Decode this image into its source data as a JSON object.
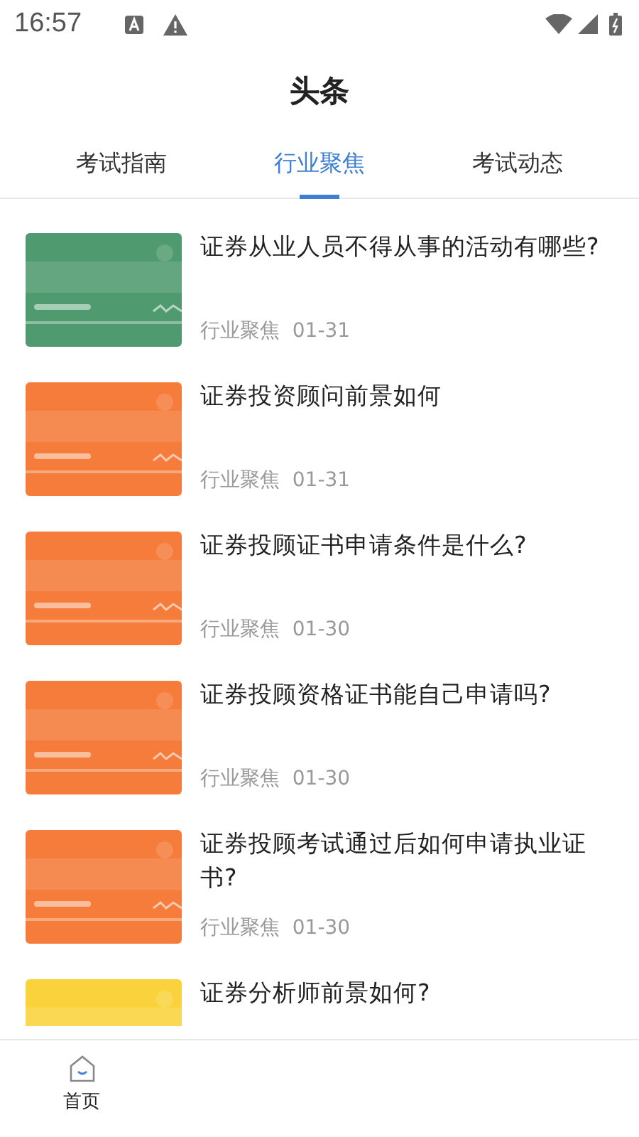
{
  "status_bar": {
    "time": "16:57"
  },
  "header": {
    "title": "头条"
  },
  "tabs": [
    {
      "label": "考试指南",
      "selected": false
    },
    {
      "label": "行业聚焦",
      "selected": true
    },
    {
      "label": "考试动态",
      "selected": false
    }
  ],
  "articles": [
    {
      "title": "证券从业人员不得从事的活动有哪些?",
      "category": "行业聚焦",
      "date": "01-31",
      "color": "#4f9a6e"
    },
    {
      "title": "证券投资顾问前景如何",
      "category": "行业聚焦",
      "date": "01-31",
      "color": "#f57c3a"
    },
    {
      "title": "证券投顾证书申请条件是什么?",
      "category": "行业聚焦",
      "date": "01-30",
      "color": "#f57c3a"
    },
    {
      "title": "证券投顾资格证书能自己申请吗?",
      "category": "行业聚焦",
      "date": "01-30",
      "color": "#f57c3a"
    },
    {
      "title": "证券投顾考试通过后如何申请执业证书?",
      "category": "行业聚焦",
      "date": "01-30",
      "color": "#f57c3a"
    },
    {
      "title": "证券分析师前景如何?",
      "color": "#fad33c"
    }
  ],
  "bottom_nav": [
    {
      "label": "首页",
      "selected": true
    }
  ]
}
